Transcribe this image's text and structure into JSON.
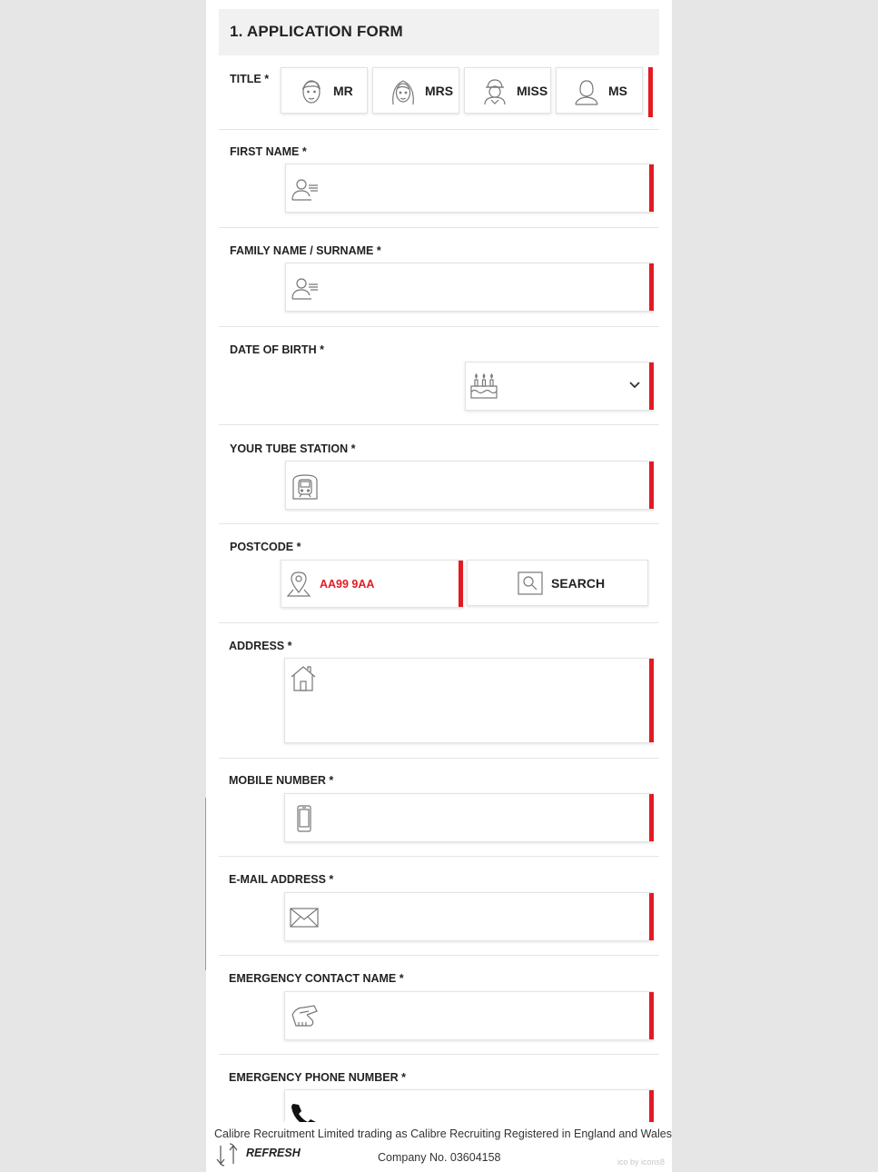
{
  "form": {
    "heading": "1. APPLICATION FORM",
    "accent_color": "#e21b23",
    "title": {
      "label": "TITLE *",
      "options": [
        {
          "label": "MR",
          "icon": "man-face-icon"
        },
        {
          "label": "MRS",
          "icon": "woman-face-icon"
        },
        {
          "label": "MISS",
          "icon": "girl-cap-icon"
        },
        {
          "label": "MS",
          "icon": "woman-outline-icon"
        }
      ]
    },
    "first_name": {
      "label": "FIRST NAME *",
      "icon": "user-card-icon",
      "value": ""
    },
    "family_name": {
      "label": "FAMILY NAME / SURNAME *",
      "icon": "user-card-icon",
      "value": ""
    },
    "date_of_birth": {
      "label": "DATE OF BIRTH *",
      "icon": "birthday-cake-icon",
      "value": ""
    },
    "tube_station": {
      "label": "YOUR TUBE STATION *",
      "icon": "train-icon",
      "value": ""
    },
    "postcode": {
      "label": "POSTCODE *",
      "icon": "map-pin-icon",
      "placeholder": "AA99 9AA",
      "search_label": "SEARCH"
    },
    "address": {
      "label": "ADDRESS *",
      "icon": "house-icon",
      "value": ""
    },
    "mobile": {
      "label": "MOBILE NUMBER *",
      "icon": "mobile-phone-icon",
      "value": ""
    },
    "email": {
      "label": "E-MAIL ADDRESS *",
      "icon": "envelope-icon",
      "value": ""
    },
    "emergency_name": {
      "label": "EMERGENCY CONTACT NAME *",
      "icon": "handshake-icon",
      "value": ""
    },
    "emergency_phone": {
      "label": "EMERGENCY PHONE NUMBER *",
      "icon": "phone-handset-icon",
      "value": ""
    }
  },
  "footer": {
    "line1": "Calibre Recruitment Limited trading as Calibre Recruiting Registered in England and Wales",
    "line2": "Company No. 03604158",
    "refresh_label": "REFRESH",
    "credit": "ico by icons8"
  }
}
